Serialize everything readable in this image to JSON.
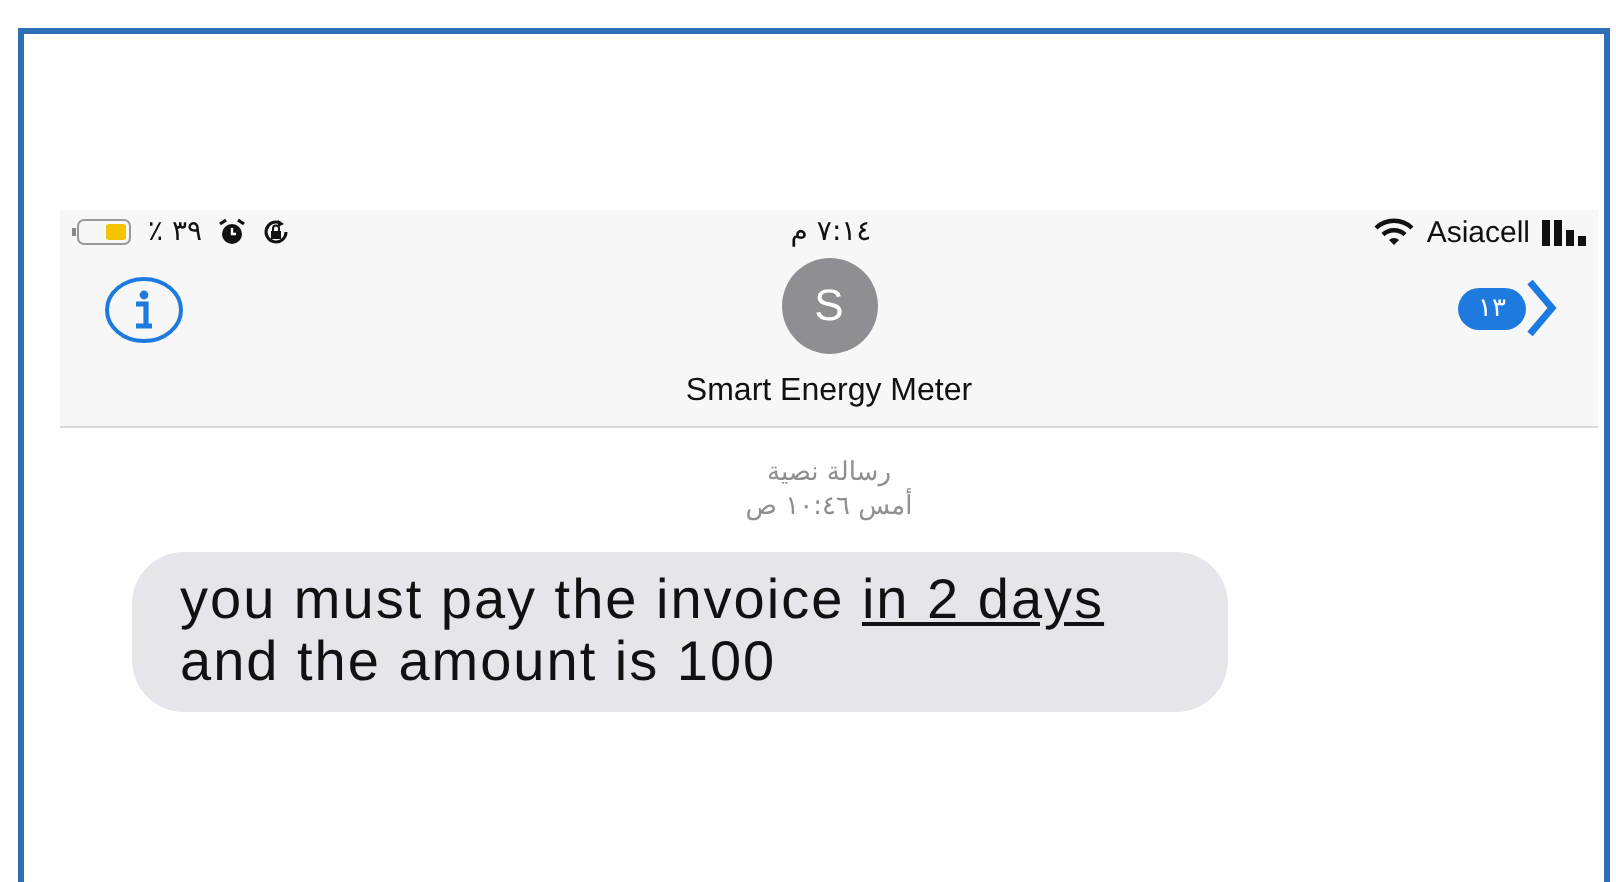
{
  "status_bar": {
    "battery_percent": "٪ ٣٩",
    "time": "٧:١٤ م",
    "carrier": "Asiacell"
  },
  "header": {
    "avatar_initial": "S",
    "contact_name": "Smart Energy Meter",
    "unread_badge": "١٣"
  },
  "conversation": {
    "message_type": "رسالة نصية",
    "timestamp": "أمس ١٠:٤٦ ص",
    "messages": [
      {
        "text_before_link": "you must pay the invoice",
        "link": "in 2 days",
        "text_after_link": "and the amount is 100"
      }
    ]
  }
}
